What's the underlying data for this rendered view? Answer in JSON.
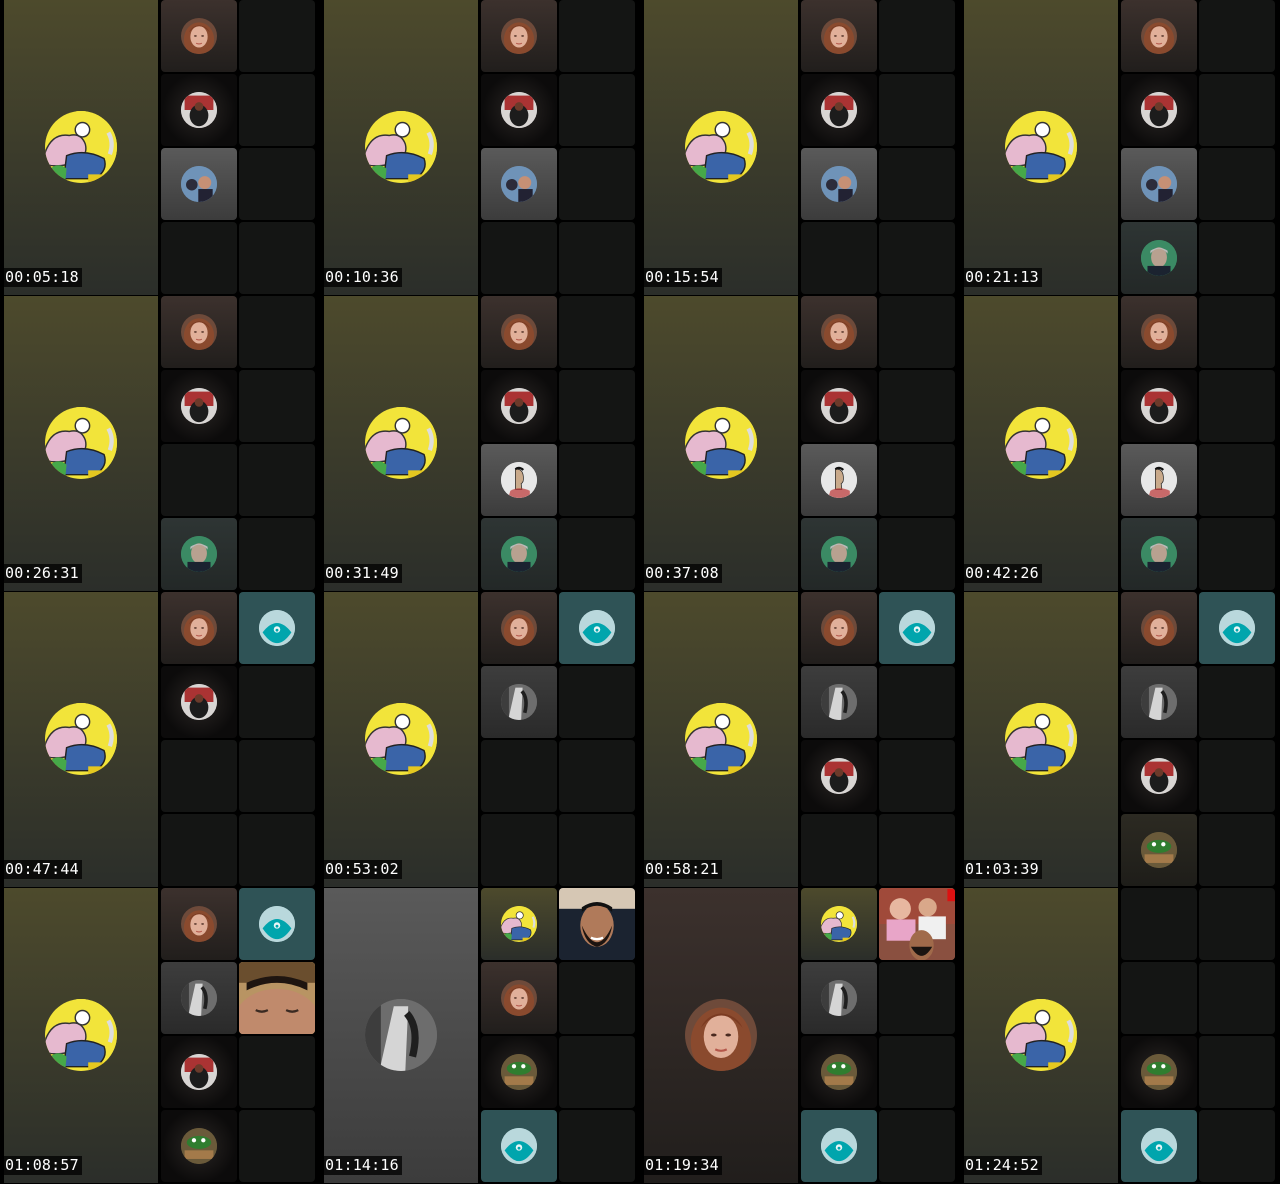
{
  "frames": [
    {
      "timestamp": "00:05:18",
      "main": {
        "bg": "olive",
        "avatar": "cartoon-avatar"
      },
      "tiles": [
        [
          "brown",
          "woman-avatar"
        ],
        [
          "dark",
          "jersey-avatar"
        ],
        [
          "grey",
          "group-selfie-avatar"
        ],
        [
          "empty",
          ""
        ],
        [
          "empty",
          ""
        ],
        [
          "empty",
          ""
        ],
        [
          "empty",
          ""
        ],
        [
          "empty",
          ""
        ]
      ]
    },
    {
      "timestamp": "00:10:36",
      "main": {
        "bg": "olive",
        "avatar": "cartoon-avatar"
      },
      "tiles": [
        [
          "brown",
          "woman-avatar"
        ],
        [
          "dark",
          "jersey-avatar"
        ],
        [
          "grey",
          "group-selfie-avatar"
        ],
        [
          "empty",
          ""
        ],
        [
          "empty",
          ""
        ],
        [
          "empty",
          ""
        ],
        [
          "empty",
          ""
        ],
        [
          "empty",
          ""
        ]
      ]
    },
    {
      "timestamp": "00:15:54",
      "main": {
        "bg": "olive",
        "avatar": "cartoon-avatar"
      },
      "tiles": [
        [
          "brown",
          "woman-avatar"
        ],
        [
          "dark",
          "jersey-avatar"
        ],
        [
          "grey",
          "group-selfie-avatar"
        ],
        [
          "empty",
          ""
        ],
        [
          "empty",
          ""
        ],
        [
          "empty",
          ""
        ],
        [
          "empty",
          ""
        ],
        [
          "empty",
          ""
        ]
      ]
    },
    {
      "timestamp": "00:21:13",
      "main": {
        "bg": "olive",
        "avatar": "cartoon-avatar"
      },
      "tiles": [
        [
          "brown",
          "woman-avatar"
        ],
        [
          "dark",
          "jersey-avatar"
        ],
        [
          "grey",
          "group-selfie-avatar"
        ],
        [
          "slate",
          "man-portrait-avatar"
        ],
        [
          "empty",
          ""
        ],
        [
          "empty",
          ""
        ],
        [
          "empty",
          ""
        ],
        [
          "empty",
          ""
        ]
      ]
    },
    {
      "timestamp": "00:26:31",
      "main": {
        "bg": "olive",
        "avatar": "cartoon-avatar"
      },
      "tiles": [
        [
          "brown",
          "woman-avatar"
        ],
        [
          "dark",
          "jersey-avatar"
        ],
        [
          "empty",
          ""
        ],
        [
          "slate",
          "man-portrait-avatar"
        ],
        [
          "empty",
          ""
        ],
        [
          "empty",
          ""
        ],
        [
          "empty",
          ""
        ],
        [
          "empty",
          ""
        ]
      ]
    },
    {
      "timestamp": "00:31:49",
      "main": {
        "bg": "olive",
        "avatar": "cartoon-avatar"
      },
      "tiles": [
        [
          "brown",
          "woman-avatar"
        ],
        [
          "dark",
          "jersey-avatar"
        ],
        [
          "grey",
          "profile-drawing-avatar"
        ],
        [
          "slate",
          "man-portrait-avatar"
        ],
        [
          "empty",
          ""
        ],
        [
          "empty",
          ""
        ],
        [
          "empty",
          ""
        ],
        [
          "empty",
          ""
        ]
      ]
    },
    {
      "timestamp": "00:37:08",
      "main": {
        "bg": "olive",
        "avatar": "cartoon-avatar"
      },
      "tiles": [
        [
          "brown",
          "woman-avatar"
        ],
        [
          "dark",
          "jersey-avatar"
        ],
        [
          "grey",
          "profile-drawing-avatar"
        ],
        [
          "slate",
          "man-portrait-avatar"
        ],
        [
          "empty",
          ""
        ],
        [
          "empty",
          ""
        ],
        [
          "empty",
          ""
        ],
        [
          "empty",
          ""
        ]
      ]
    },
    {
      "timestamp": "00:42:26",
      "main": {
        "bg": "olive",
        "avatar": "cartoon-avatar"
      },
      "tiles": [
        [
          "brown",
          "woman-avatar"
        ],
        [
          "dark",
          "jersey-avatar"
        ],
        [
          "grey",
          "profile-drawing-avatar"
        ],
        [
          "slate",
          "man-portrait-avatar"
        ],
        [
          "empty",
          ""
        ],
        [
          "empty",
          ""
        ],
        [
          "empty",
          ""
        ],
        [
          "empty",
          ""
        ]
      ]
    },
    {
      "timestamp": "00:47:44",
      "main": {
        "bg": "olive",
        "avatar": "cartoon-avatar"
      },
      "tiles": [
        [
          "brown",
          "woman-avatar"
        ],
        [
          "dark",
          "jersey-avatar"
        ],
        [
          "empty",
          ""
        ],
        [
          "empty",
          ""
        ],
        [
          "teal",
          "teal-logo-avatar"
        ],
        [
          "empty",
          ""
        ],
        [
          "empty",
          ""
        ],
        [
          "empty",
          ""
        ]
      ]
    },
    {
      "timestamp": "00:53:02",
      "main": {
        "bg": "olive",
        "avatar": "cartoon-avatar"
      },
      "tiles": [
        [
          "brown",
          "woman-avatar"
        ],
        [
          "greydark",
          "bw-photo-avatar"
        ],
        [
          "empty",
          ""
        ],
        [
          "empty",
          ""
        ],
        [
          "teal",
          "teal-logo-avatar"
        ],
        [
          "empty",
          ""
        ],
        [
          "empty",
          ""
        ],
        [
          "empty",
          ""
        ]
      ]
    },
    {
      "timestamp": "00:58:21",
      "main": {
        "bg": "olive",
        "avatar": "cartoon-avatar"
      },
      "tiles": [
        [
          "brown",
          "woman-avatar"
        ],
        [
          "greydark",
          "bw-photo-avatar"
        ],
        [
          "dark",
          "jersey-avatar"
        ],
        [
          "empty",
          ""
        ],
        [
          "teal",
          "teal-logo-avatar"
        ],
        [
          "empty",
          ""
        ],
        [
          "empty",
          ""
        ],
        [
          "empty",
          ""
        ]
      ]
    },
    {
      "timestamp": "01:03:39",
      "main": {
        "bg": "olive",
        "avatar": "cartoon-avatar"
      },
      "tiles": [
        [
          "brown",
          "woman-avatar"
        ],
        [
          "greydark",
          "bw-photo-avatar"
        ],
        [
          "dark",
          "jersey-avatar"
        ],
        [
          "olivedark",
          "frog-avatar"
        ],
        [
          "teal",
          "teal-logo-avatar"
        ],
        [
          "empty",
          ""
        ],
        [
          "empty",
          ""
        ],
        [
          "empty",
          ""
        ]
      ]
    },
    {
      "timestamp": "01:08:57",
      "main": {
        "bg": "olive",
        "avatar": "cartoon-avatar"
      },
      "tiles": [
        [
          "brown",
          "woman-avatar"
        ],
        [
          "greydark",
          "bw-photo-avatar"
        ],
        [
          "dark",
          "jersey-avatar"
        ],
        [
          "dark",
          "frog-avatar"
        ],
        [
          "teal",
          "teal-logo-avatar"
        ],
        [
          "video",
          "closed-eyes-video"
        ],
        [
          "empty",
          ""
        ],
        [
          "empty",
          ""
        ]
      ]
    },
    {
      "timestamp": "01:14:16",
      "main": {
        "bg": "grey",
        "avatar": "bw-photo-avatar"
      },
      "tiles": [
        [
          "olive",
          "cartoon-avatar"
        ],
        [
          "brown",
          "woman-avatar"
        ],
        [
          "dark",
          "frog-avatar"
        ],
        [
          "teal",
          "teal-logo-avatar"
        ],
        [
          "video",
          "bearded-man-video"
        ],
        [
          "empty",
          ""
        ],
        [
          "empty",
          ""
        ],
        [
          "empty",
          ""
        ]
      ]
    },
    {
      "timestamp": "01:19:34",
      "main": {
        "bg": "brown",
        "avatar": "woman-avatar"
      },
      "tiles": [
        [
          "olive",
          "cartoon-avatar"
        ],
        [
          "greydark",
          "bw-photo-avatar"
        ],
        [
          "dark",
          "frog-avatar"
        ],
        [
          "teal",
          "teal-logo-avatar"
        ],
        [
          "video",
          "group-video"
        ],
        [
          "empty",
          ""
        ],
        [
          "empty",
          ""
        ],
        [
          "empty",
          ""
        ]
      ]
    },
    {
      "timestamp": "01:24:52",
      "main": {
        "bg": "olive",
        "avatar": "cartoon-avatar"
      },
      "tiles": [
        [
          "empty",
          ""
        ],
        [
          "empty",
          ""
        ],
        [
          "dark",
          "frog-avatar"
        ],
        [
          "teal",
          "teal-logo-avatar"
        ],
        [
          "empty",
          ""
        ],
        [
          "empty",
          ""
        ],
        [
          "empty",
          ""
        ],
        [
          "empty",
          ""
        ]
      ]
    }
  ],
  "colors": {
    "olive_top": "#4d4a2c",
    "olive_bot": "#2b2e2a",
    "grey_top": "#5a5a5a",
    "grey_bot": "#3c3c3c",
    "brown_top": "#3c312d",
    "brown_bot": "#211e1c",
    "tile_empty": "#141514",
    "teal": "#2f5356",
    "teal_logo": "#00a5ad"
  }
}
